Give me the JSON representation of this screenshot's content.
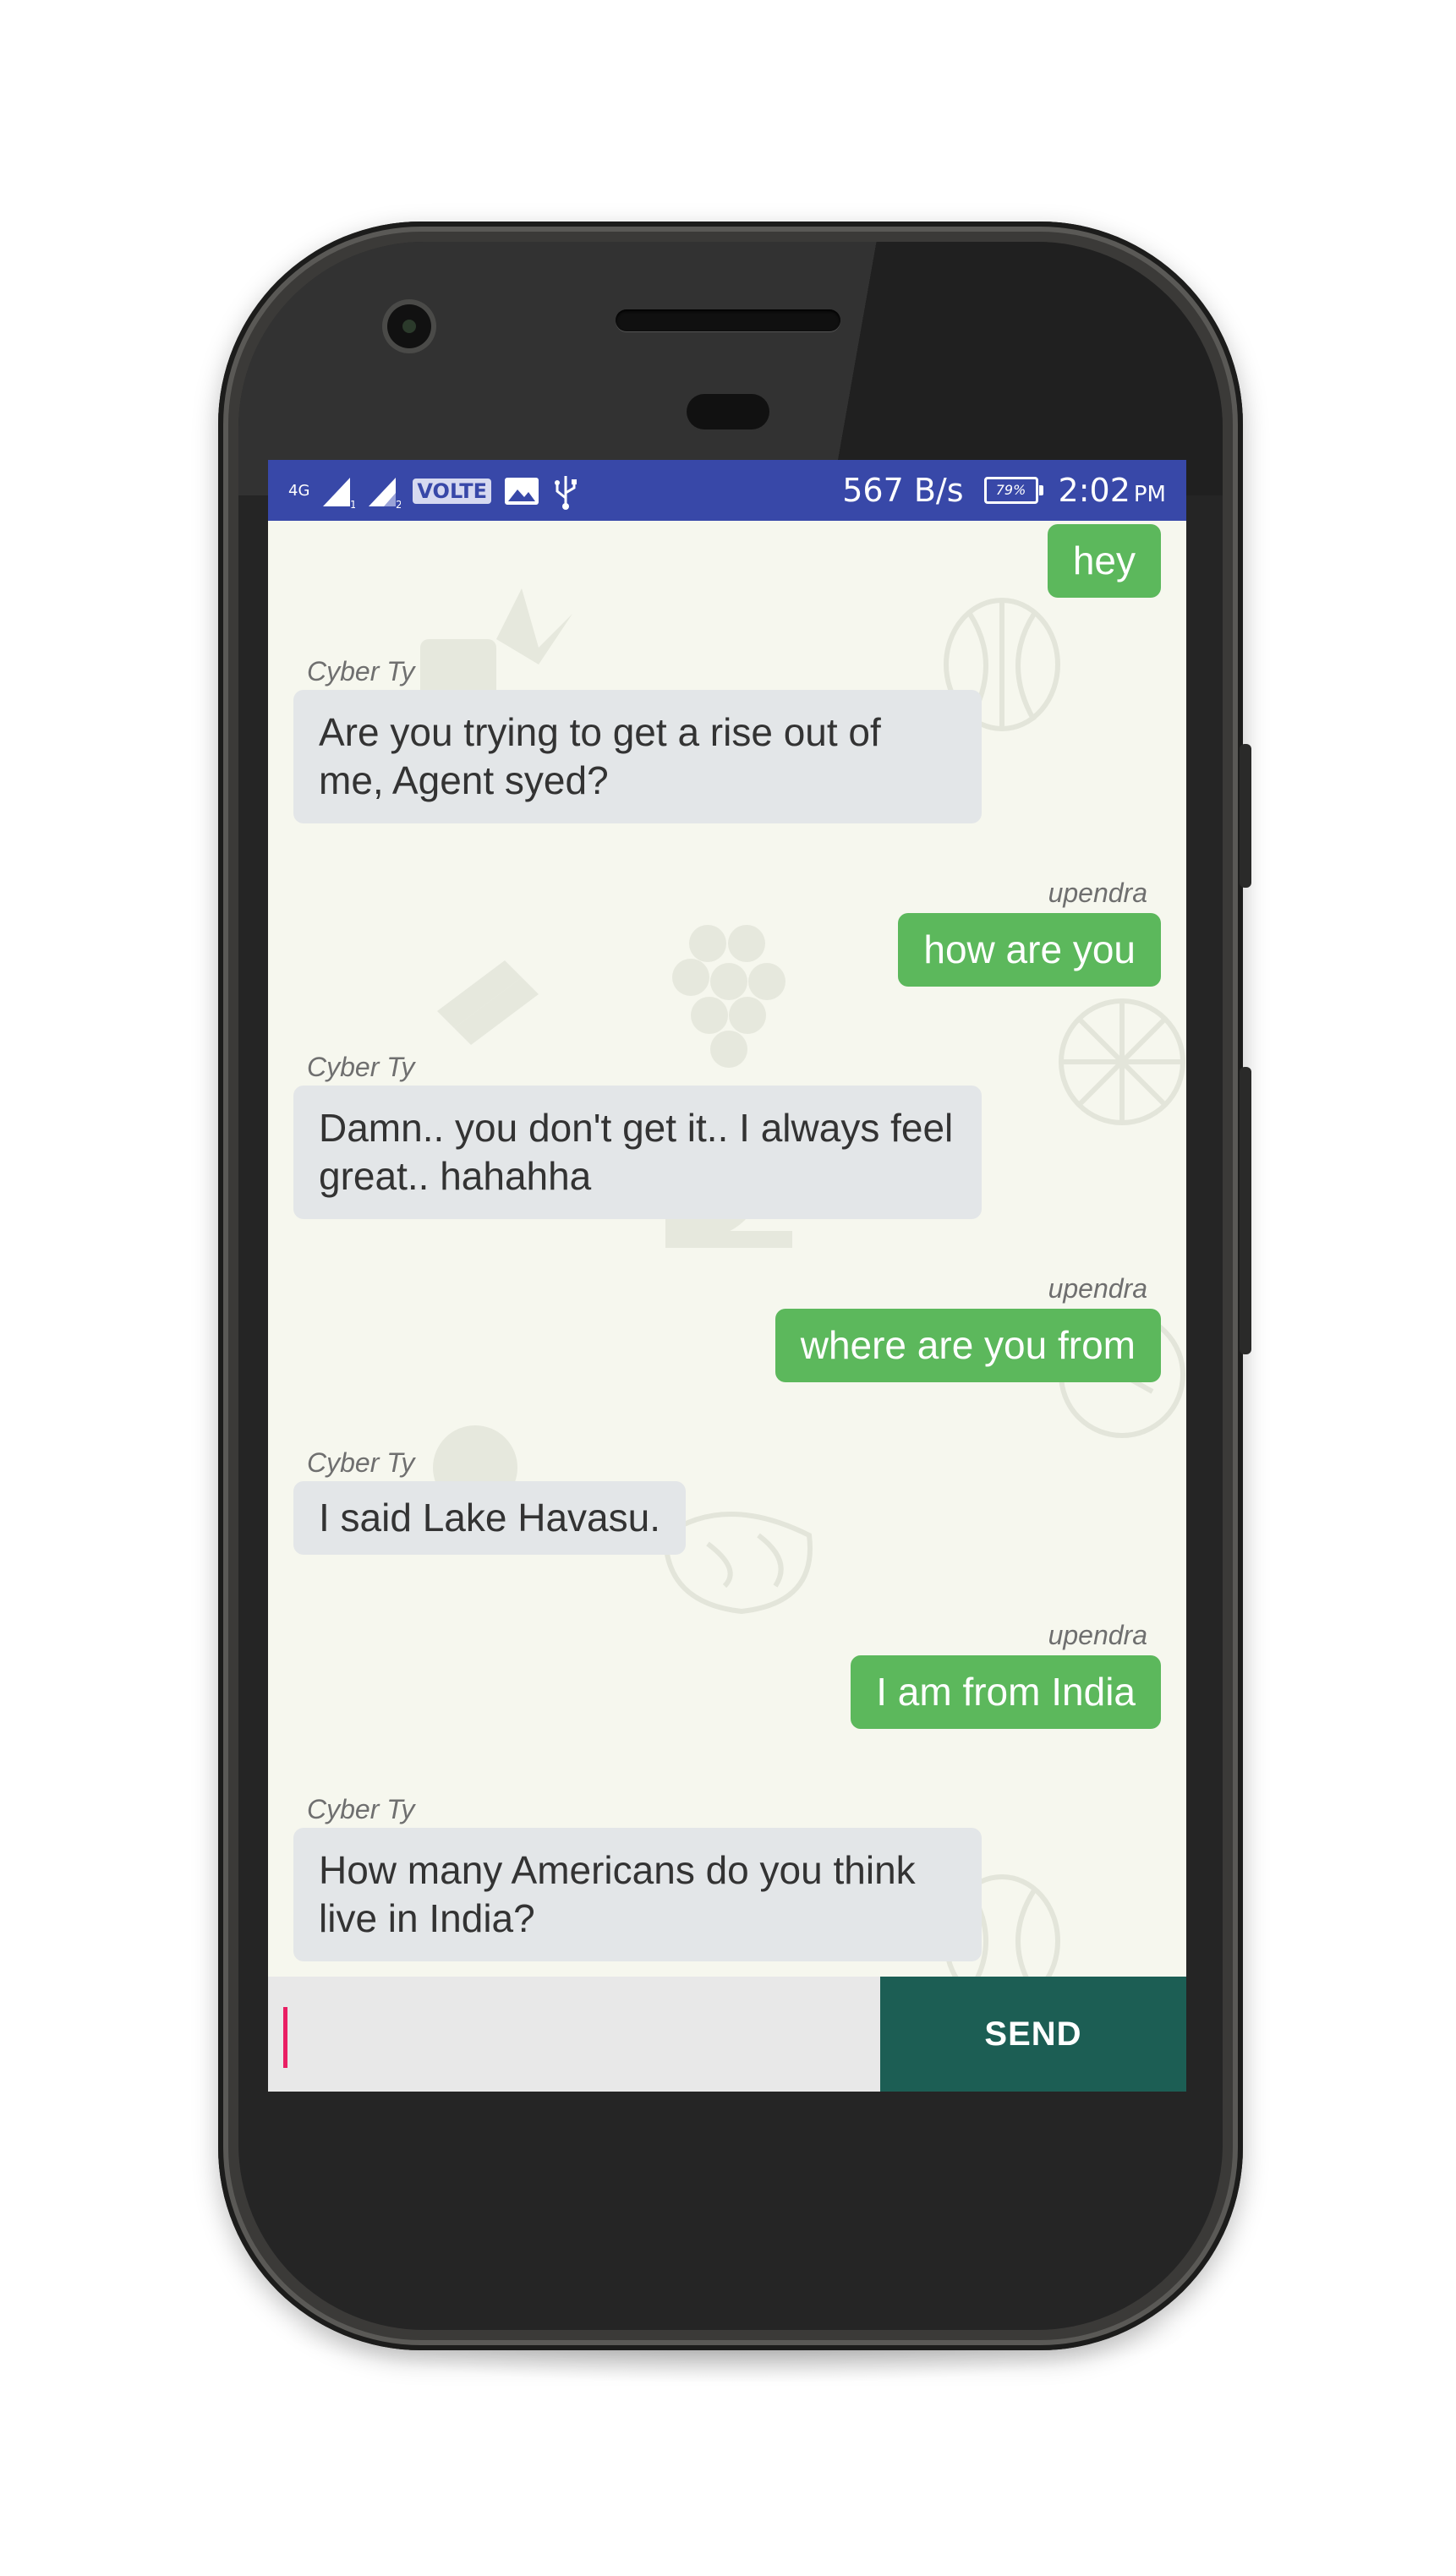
{
  "status_bar": {
    "network_type": "4G",
    "sim1_label": "1",
    "sim2_label": "2",
    "volte": "VOLTE",
    "speed": "567 B/s",
    "battery": "79%",
    "time": "2:02",
    "ampm": "PM",
    "icons": [
      "signal-sim1-icon",
      "signal-sim2-icon",
      "image-notification-icon",
      "usb-icon",
      "battery-icon"
    ]
  },
  "chat": {
    "messages": [
      {
        "direction": "outgoing",
        "sender": "",
        "text": "hey"
      },
      {
        "direction": "incoming",
        "sender": "Cyber Ty",
        "text": "Are you trying to get a rise out of me, Agent syed?"
      },
      {
        "direction": "outgoing",
        "sender": "upendra",
        "text": "how are you"
      },
      {
        "direction": "incoming",
        "sender": "Cyber Ty",
        "text": "Damn.. you don't get it.. I always feel great.. hahahha"
      },
      {
        "direction": "outgoing",
        "sender": "upendra",
        "text": "where are you from"
      },
      {
        "direction": "incoming",
        "sender": "Cyber Ty",
        "text": "I said Lake Havasu."
      },
      {
        "direction": "outgoing",
        "sender": "upendra",
        "text": "I am from India"
      },
      {
        "direction": "incoming",
        "sender": "Cyber Ty",
        "text": "How many Americans do you think live in India?"
      }
    ]
  },
  "composer": {
    "input_value": "",
    "send_label": "SEND"
  },
  "colors": {
    "status_bar": "#3848a8",
    "outgoing_bubble": "#5cb85c",
    "incoming_bubble": "#e3e6e8",
    "send_button": "#1c5e54",
    "chat_background": "#f6f7ee",
    "cursor": "#e91e63"
  }
}
